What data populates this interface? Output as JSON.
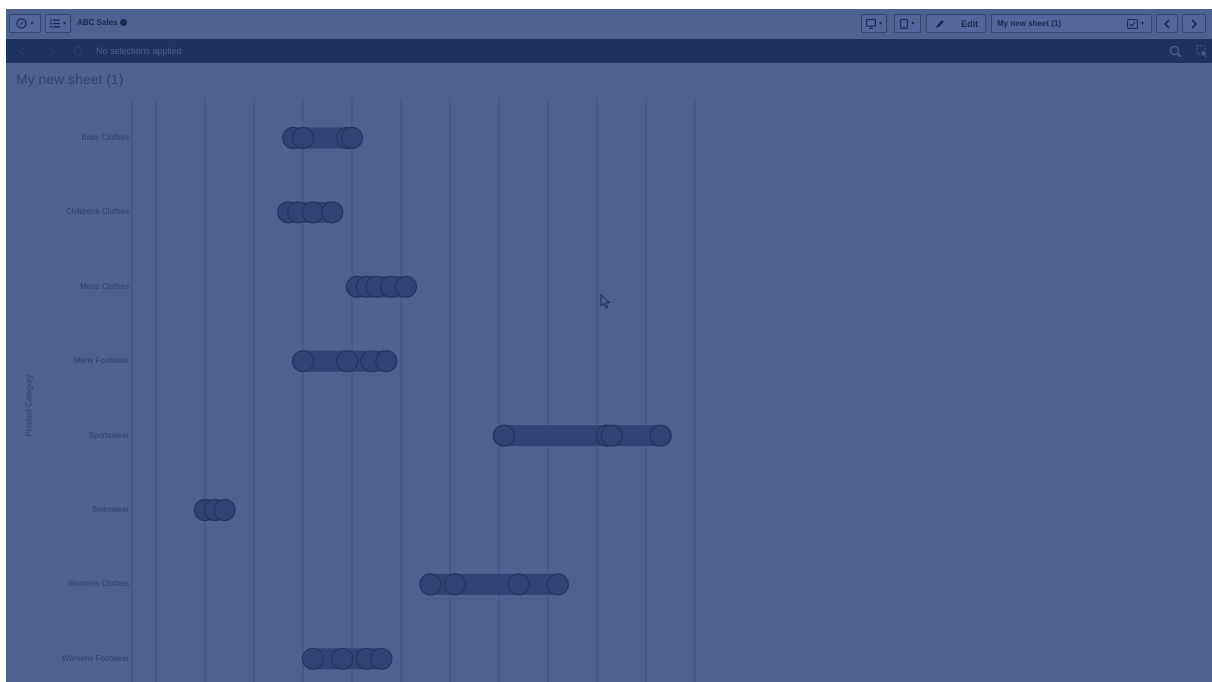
{
  "toolbar": {
    "app_name": "ABC Sales",
    "edit_label": "Edit",
    "sheet_name": "My new sheet (1)"
  },
  "selections": {
    "status_text": "No selections applied"
  },
  "sheet": {
    "title": "My new sheet (1)"
  },
  "icons": [
    "compass-icon",
    "list-menu-icon",
    "globe-icon",
    "present-icon",
    "device-icon",
    "pencil-icon",
    "bookmark-icon",
    "chevron-left-icon",
    "chevron-right-icon",
    "search-icon",
    "selection-tool-icon"
  ],
  "colors": {
    "overlay_bg": "#4d6290",
    "selection_bar": "#1d3361",
    "bar_fill": "#2f4474",
    "bar_stroke": "#22345e",
    "gridline": "#3d5183",
    "text": "#2c3f6c"
  },
  "chart_data": {
    "type": "scatter",
    "subtype": "distribution-plot",
    "ylabel": "Product Category",
    "xlabel": "",
    "categories": [
      "Baby Clothes",
      "Childrens Clothes",
      "Mens Clothes",
      "Mens Footwear",
      "Sportswear",
      "Swimwear",
      "Womens Clothes",
      "Womens Footwear"
    ],
    "x_ticks_count": 11,
    "grid": true,
    "series": [
      {
        "category": "Baby Clothes",
        "points": [
          3.3,
          3.5,
          4.4,
          4.5
        ]
      },
      {
        "category": "Childrens Clothes",
        "points": [
          3.2,
          3.4,
          3.7,
          4.1
        ]
      },
      {
        "category": "Mens Clothes",
        "points": [
          4.6,
          4.8,
          5.0,
          5.3,
          5.6
        ]
      },
      {
        "category": "Mens Footwear",
        "points": [
          3.5,
          4.4,
          4.9,
          5.2
        ]
      },
      {
        "category": "Sportswear",
        "points": [
          7.6,
          9.7,
          9.8,
          10.8
        ]
      },
      {
        "category": "Swimwear",
        "points": [
          1.5,
          1.7,
          1.9
        ]
      },
      {
        "category": "Womens Clothes",
        "points": [
          6.1,
          6.6,
          7.9,
          8.7
        ]
      },
      {
        "category": "Womens Footwear",
        "points": [
          3.7,
          4.3,
          4.8,
          5.1
        ]
      }
    ]
  }
}
